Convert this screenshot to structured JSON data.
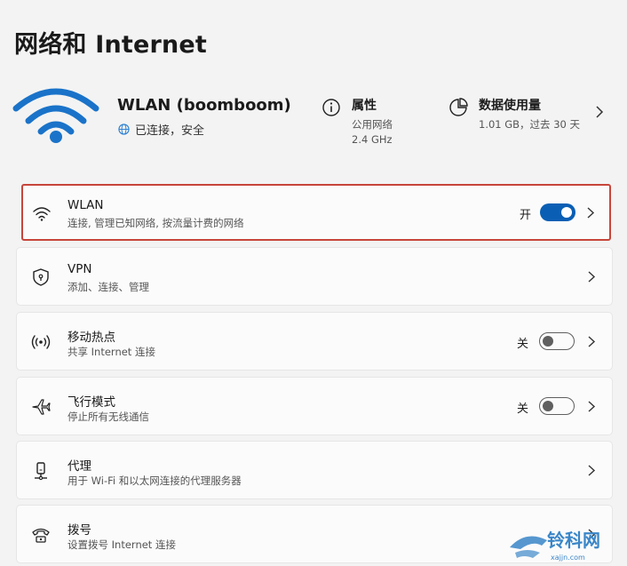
{
  "page": {
    "title": "网络和 Internet"
  },
  "status": {
    "ssid": "WLAN (boomboom)",
    "connection": "已连接，安全",
    "properties": {
      "title": "属性",
      "line1": "公用网络",
      "line2": "2.4 GHz"
    },
    "data_usage": {
      "title": "数据使用量",
      "line1": "1.01 GB，过去 30 天"
    }
  },
  "items": [
    {
      "icon": "wifi-icon",
      "title": "WLAN",
      "subtitle": "连接, 管理已知网络, 按流量计费的网络",
      "state": "开",
      "toggle": true,
      "selected": true
    },
    {
      "icon": "shield-icon",
      "title": "VPN",
      "subtitle": "添加、连接、管理"
    },
    {
      "icon": "hotspot-icon",
      "title": "移动热点",
      "subtitle": "共享 Internet 连接",
      "state": "关",
      "toggle": false
    },
    {
      "icon": "airplane-icon",
      "title": "飞行模式",
      "subtitle": "停止所有无线通信",
      "state": "关",
      "toggle": false
    },
    {
      "icon": "proxy-icon",
      "title": "代理",
      "subtitle": "用于 Wi-Fi 和以太网连接的代理服务器"
    },
    {
      "icon": "dialup-icon",
      "title": "拨号",
      "subtitle": "设置拨号 Internet 连接"
    }
  ],
  "watermark": {
    "text": "铃科网",
    "url": "xajjn.com"
  },
  "colors": {
    "accent": "#0a5fb4",
    "highlight_border": "#c8453a",
    "background": "#f3f3f3"
  }
}
